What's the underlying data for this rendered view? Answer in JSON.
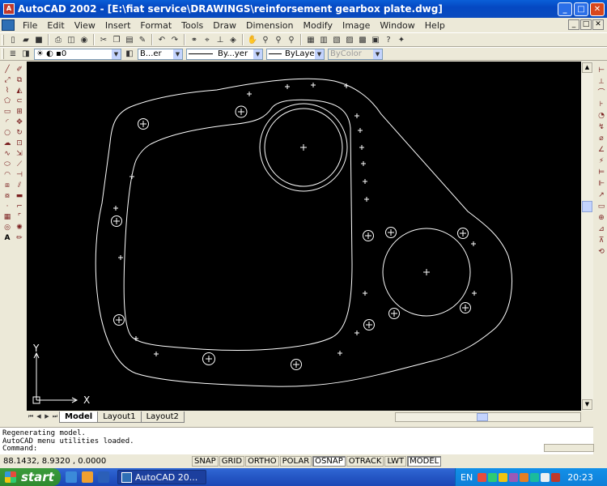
{
  "window": {
    "title": "AutoCAD 2002 - [E:\\fiat service\\DRAWINGS\\reinforsement gearbox plate.dwg]",
    "minimize": "_",
    "maximize": "□",
    "close": "✕"
  },
  "menubar": {
    "items": [
      "File",
      "Edit",
      "View",
      "Insert",
      "Format",
      "Tools",
      "Draw",
      "Dimension",
      "Modify",
      "Image",
      "Window",
      "Help"
    ],
    "mdi_min": "_",
    "mdi_max": "□",
    "mdi_close": "✕"
  },
  "layers": {
    "current_layer": "0",
    "color": "B...er",
    "linetype": "By...yer",
    "lineweight": "ByLayer",
    "plotstyle": "ByColor"
  },
  "ucs": {
    "y_label": "Y",
    "x_label": "X"
  },
  "tabs": {
    "model": "Model",
    "layout1": "Layout1",
    "layout2": "Layout2"
  },
  "command": {
    "lines": [
      "Regenerating model.",
      "AutoCAD menu utilities loaded."
    ],
    "prompt": "Command:"
  },
  "status": {
    "coords": "88.1432,  8.9320 , 0.0000",
    "buttons": [
      {
        "label": "SNAP",
        "on": false
      },
      {
        "label": "GRID",
        "on": false
      },
      {
        "label": "ORTHO",
        "on": false
      },
      {
        "label": "POLAR",
        "on": false
      },
      {
        "label": "OSNAP",
        "on": true
      },
      {
        "label": "OTRACK",
        "on": false
      },
      {
        "label": "LWT",
        "on": false
      },
      {
        "label": "MODEL",
        "on": true
      }
    ]
  },
  "taskbar": {
    "start": "start",
    "task": "AutoCAD 20...",
    "lang": "EN",
    "clock": "20:23"
  },
  "colors": {
    "canvas": "#000000",
    "geometry": "#ffffff",
    "titlebar": "#0a5fd8",
    "taskbar": "#2456c4",
    "start": "#3c9b3c"
  }
}
